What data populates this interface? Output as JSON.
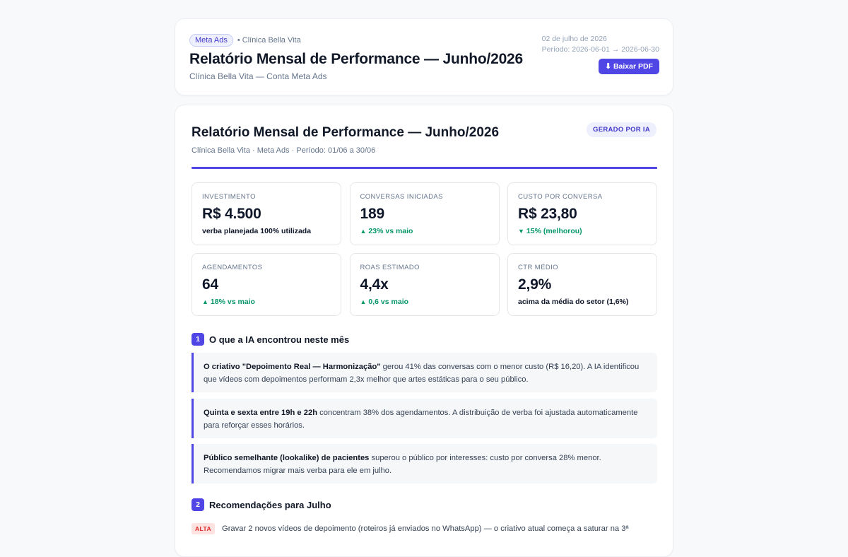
{
  "header": {
    "platform_badge": "Meta Ads",
    "client": "• Clínica Bella Vita",
    "title": "Relatório Mensal de Performance — Junho/2026",
    "subtitle": "Clínica Bella Vita — Conta Meta Ads",
    "date": "02 de julho de 2026",
    "period": "Período: 2026-06-01 → 2026-06-30",
    "download_icon": "download-icon",
    "download_label": "⬇ Baixar PDF"
  },
  "report": {
    "title": "Relatório Mensal de Performance — Junho/2026",
    "subtitle": "Clínica Bella Vita · Meta Ads · Período: 01/06 a 30/06",
    "ai_badge": "GERADO POR IA",
    "accent_color": "#4f46e5",
    "positive_color": "#059669"
  },
  "kpis": [
    {
      "label": "INVESTIMENTO",
      "value": "R$ 4.500",
      "note": "verba planejada 100% utilizada",
      "trend": ""
    },
    {
      "label": "CONVERSAS INICIADAS",
      "value": "189",
      "note": "23% vs maio",
      "trend": "▲"
    },
    {
      "label": "CUSTO POR CONVERSA",
      "value": "R$ 23,80",
      "note": "15% (melhorou)",
      "trend": "▼"
    },
    {
      "label": "AGENDAMENTOS",
      "value": "64",
      "note": "18% vs maio",
      "trend": "▲"
    },
    {
      "label": "ROAS ESTIMADO",
      "value": "4,4x",
      "note": "0,6 vs maio",
      "trend": "▲"
    },
    {
      "label": "CTR MÉDIO",
      "value": "2,9%",
      "note": "acima da média do setor (1,6%)",
      "trend": ""
    }
  ],
  "sections": {
    "findings": {
      "number": "1",
      "title": "O que a IA encontrou neste mês",
      "items": [
        {
          "bold": "O criativo \"Depoimento Real — Harmonização\"",
          "text": " gerou 41% das conversas com o menor custo (R$ 16,20). A IA identificou que vídeos com depoimentos performam 2,3x melhor que artes estáticas para o seu público."
        },
        {
          "bold": "Quinta e sexta entre 19h e 22h",
          "text": " concentram 38% dos agendamentos. A distribuição de verba foi ajustada automaticamente para reforçar esses horários."
        },
        {
          "bold": "Público semelhante (lookalike) de pacientes",
          "text": " superou o público por interesses: custo por conversa 28% menor. Recomendamos migrar mais verba para ele em julho."
        }
      ]
    },
    "recommendations": {
      "number": "2",
      "title": "Recomendações para Julho",
      "items": [
        {
          "priority": "ALTA",
          "text": "Gravar 2 novos vídeos de depoimento (roteiros já enviados no WhatsApp) — o criativo atual começa a saturar na 3ª"
        }
      ]
    }
  }
}
